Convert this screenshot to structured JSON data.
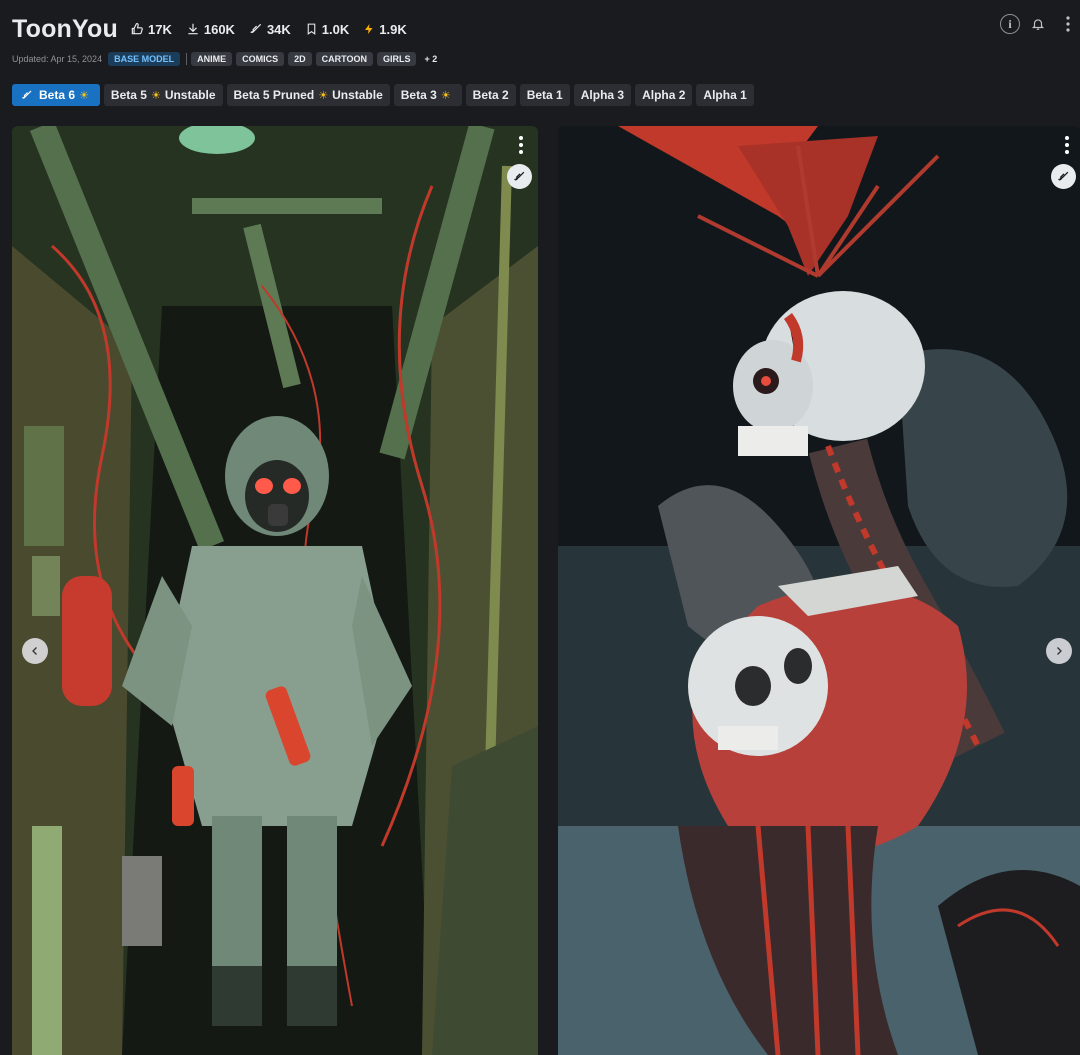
{
  "model": {
    "title": "ToonYou",
    "stats": {
      "likes": "17K",
      "downloads": "160K",
      "generations": "34K",
      "bookmarks": "1.0K",
      "buzz": "1.9K"
    },
    "updated": "Updated: Apr 15, 2024",
    "type_badge": "BASE MODEL",
    "tags": [
      "ANIME",
      "COMICS",
      "2D",
      "CARTOON",
      "GIRLS"
    ],
    "more_tags": "+ 2"
  },
  "versions": [
    {
      "label": "Beta 6",
      "suffix": "",
      "sun": true,
      "active": true
    },
    {
      "label": "Beta 5",
      "suffix": "Unstable",
      "sun": true,
      "active": false
    },
    {
      "label": "Beta 5 Pruned",
      "suffix": "Unstable",
      "sun": true,
      "active": false
    },
    {
      "label": "Beta 3",
      "suffix": "",
      "sun": true,
      "active": false
    },
    {
      "label": "Beta 2",
      "suffix": "",
      "sun": false,
      "active": false
    },
    {
      "label": "Beta 1",
      "suffix": "",
      "sun": false,
      "active": false
    },
    {
      "label": "Alpha 3",
      "suffix": "",
      "sun": false,
      "active": false
    },
    {
      "label": "Alpha 2",
      "suffix": "",
      "sun": false,
      "active": false
    },
    {
      "label": "Alpha 1",
      "suffix": "",
      "sun": false,
      "active": false
    }
  ],
  "icons": {
    "info": "i",
    "sun": "☀"
  },
  "colors": {
    "accent": "#1971c2",
    "badge_base_text": "#74c0fc",
    "buzz": "#fab005",
    "background": "#1a1b1e"
  }
}
